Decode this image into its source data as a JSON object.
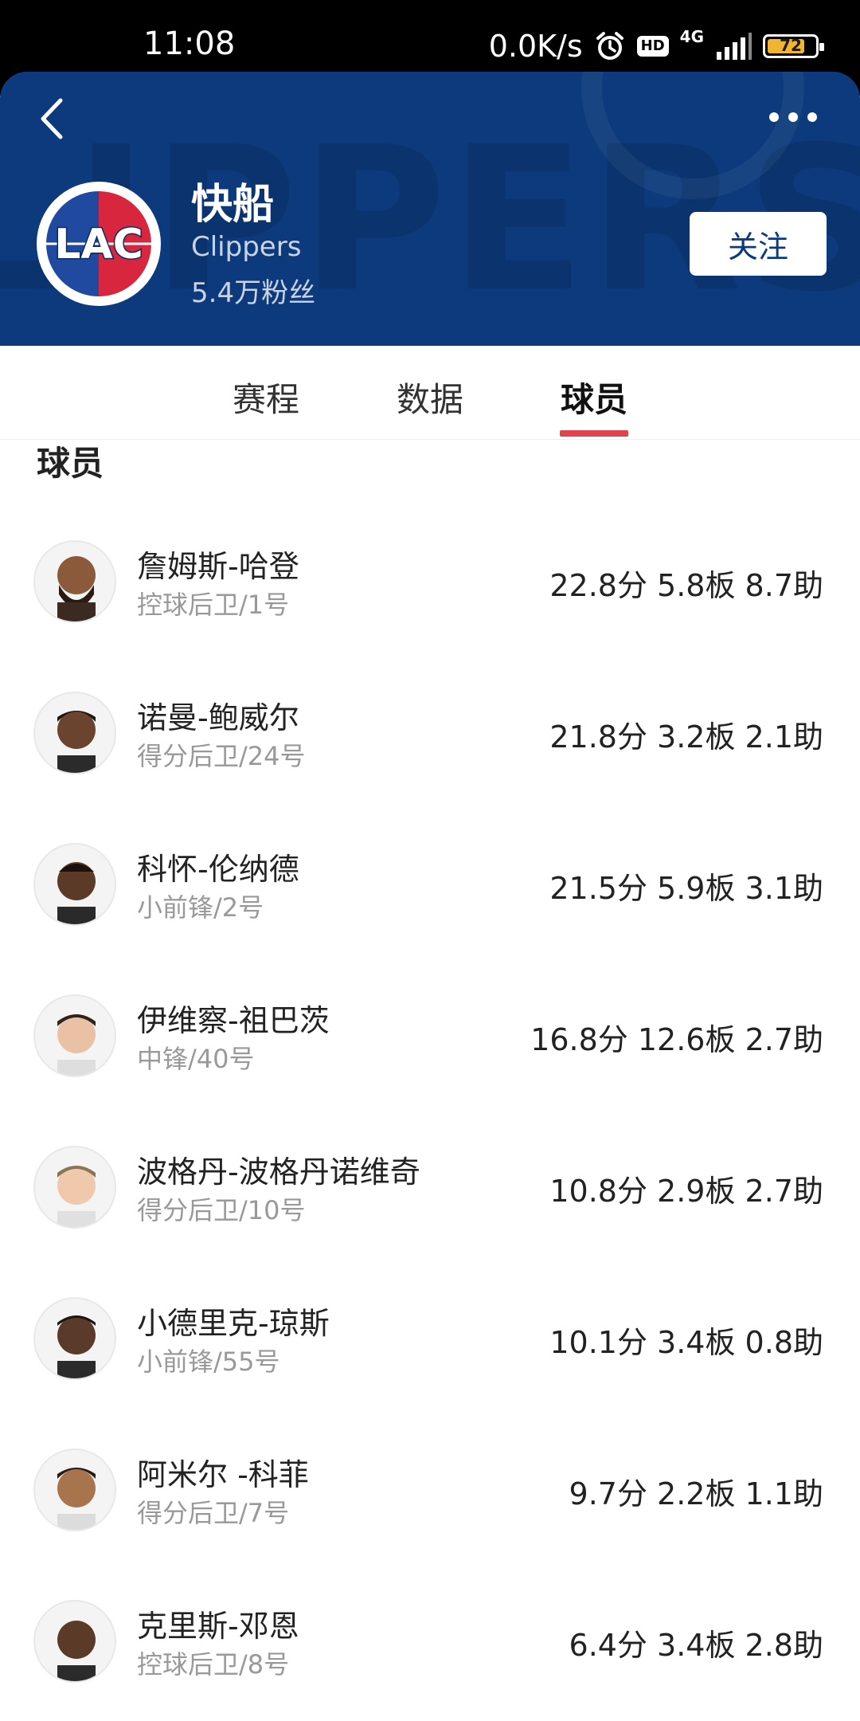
{
  "status_bar": {
    "time": "11:08",
    "network_speed": "0.0K/s",
    "hd_badge": "HD",
    "network_type": "4G",
    "battery": "72"
  },
  "header": {
    "team_name": "快船",
    "team_name_en": "Clippers",
    "fans": "5.4万粉丝",
    "follow_label": "关注",
    "logo_text": "LAC",
    "watermark_text": "CLIPPERS",
    "colors": {
      "header_bg": "#0d3a7c",
      "accent": "#e0434e",
      "logo_red": "#d7263d"
    }
  },
  "tabs": [
    {
      "label": "赛程",
      "active": false
    },
    {
      "label": "数据",
      "active": false
    },
    {
      "label": "球员",
      "active": true
    }
  ],
  "section_title": "球员",
  "players": [
    {
      "name": "詹姆斯-哈登",
      "position": "控球后卫/1号",
      "stats": "22.8分 5.8板 8.7助"
    },
    {
      "name": "诺曼-鲍威尔",
      "position": "得分后卫/24号",
      "stats": "21.8分 3.2板 2.1助"
    },
    {
      "name": "科怀-伦纳德",
      "position": "小前锋/2号",
      "stats": "21.5分 5.9板 3.1助"
    },
    {
      "name": "伊维察-祖巴茨",
      "position": "中锋/40号",
      "stats": "16.8分 12.6板 2.7助"
    },
    {
      "name": "波格丹-波格丹诺维奇",
      "position": "得分后卫/10号",
      "stats": "10.8分 2.9板 2.7助"
    },
    {
      "name": "小德里克-琼斯",
      "position": "小前锋/55号",
      "stats": "10.1分 3.4板 0.8助"
    },
    {
      "name": "阿米尔 -科菲",
      "position": "得分后卫/7号",
      "stats": "9.7分 2.2板 1.1助"
    },
    {
      "name": "克里斯-邓恩",
      "position": "控球后卫/8号",
      "stats": "6.4分 3.4板 2.8助"
    }
  ]
}
